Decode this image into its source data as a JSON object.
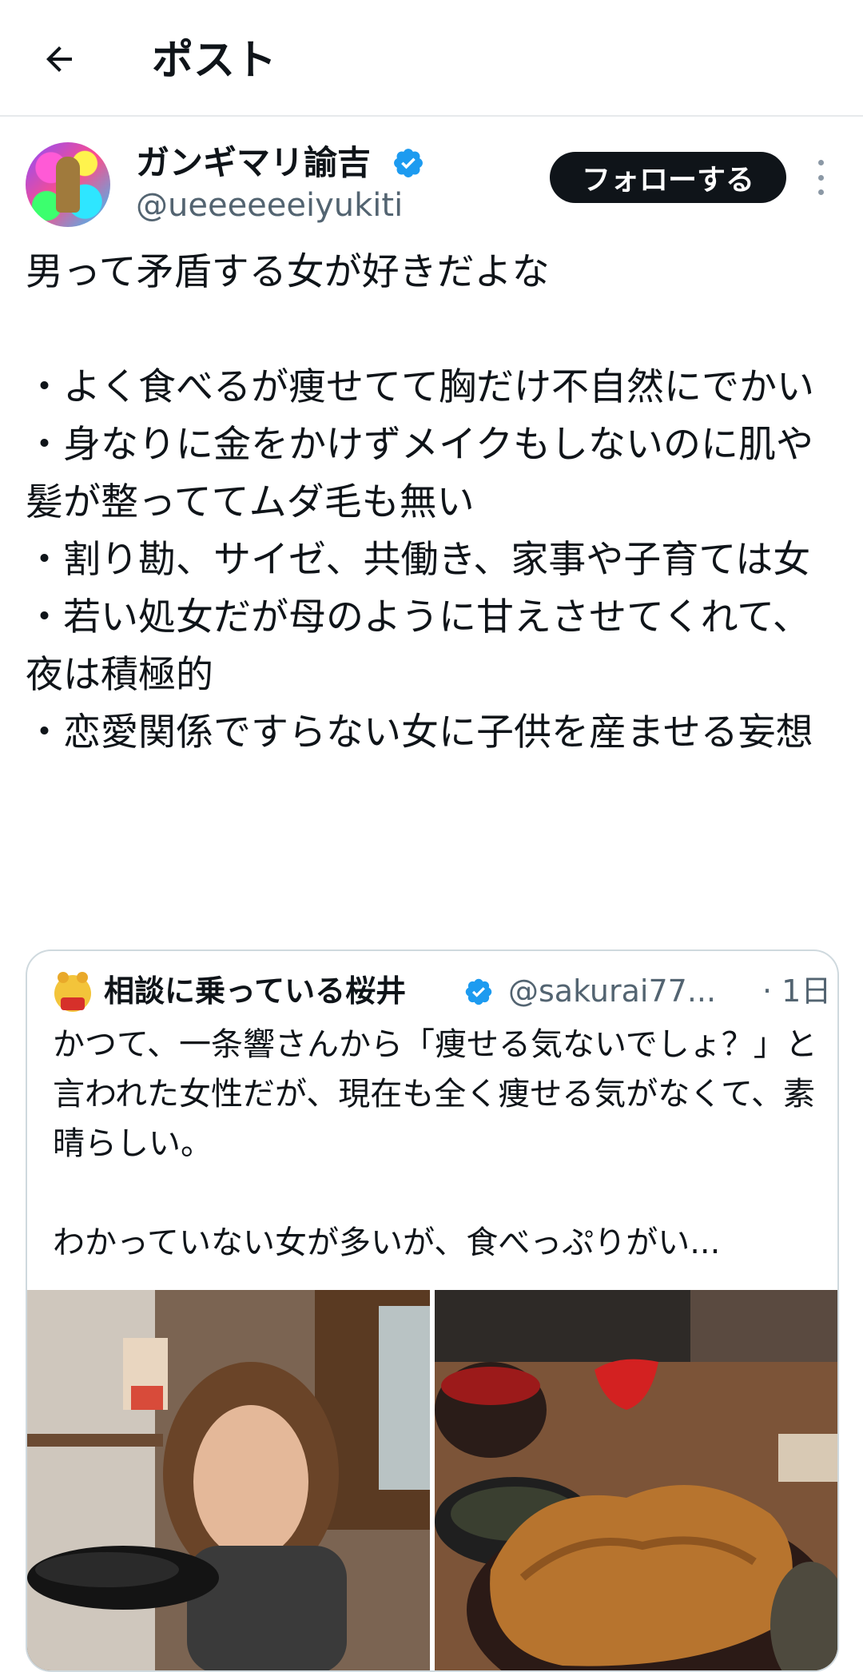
{
  "header": {
    "title": "ポスト"
  },
  "author": {
    "display_name": "ガンギマリ諭吉",
    "handle": "@ueeeeeeiyukiti"
  },
  "follow_label": "フォローする",
  "tweet": {
    "text": "男って矛盾する女が好きだよな\n\n・よく食べるが痩せてて胸だけ不自然にでかい\n・身なりに金をかけずメイクもしないのに肌や髪が整っててムダ毛も無い\n・割り勘、サイゼ、共働き、家事や子育ては女\n・若い処女だが母のように甘えさせてくれて、夜は積極的\n・恋愛関係ですらない女に子供を産ませる妄想"
  },
  "quoted": {
    "display_name": "相談に乗っている桜井",
    "handle": "@sakurai77...",
    "time": "· 1日",
    "text": "かつて、一条響さんから「痩せる気ないでしょ？」と言われた女性だが、現在も全く痩せる気がなくて、素晴らしい。\n\nわかっていない女が多いが、食べっぷりがい..."
  },
  "colors": {
    "text_primary": "#0f1419",
    "text_secondary": "#536471",
    "verified_blue": "#1d9bf0",
    "border": "#cfd9de",
    "follow_button_bg": "#0f1419"
  },
  "icons": {
    "back": "arrow-left-icon",
    "verified": "verified-badge-icon",
    "more": "more-vertical-icon"
  }
}
